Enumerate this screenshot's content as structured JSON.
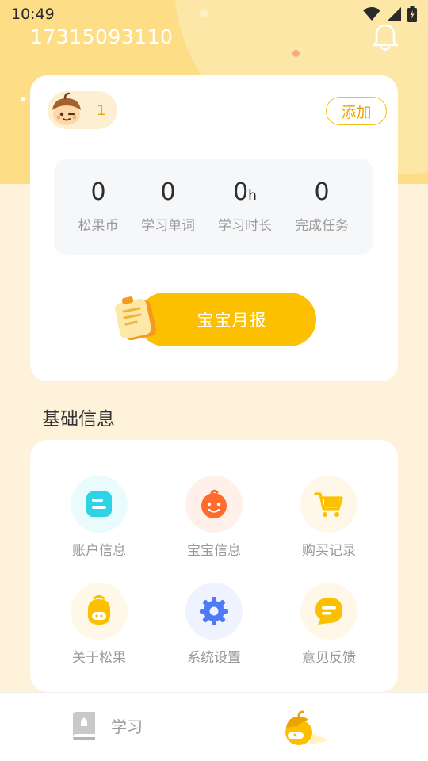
{
  "status_bar": {
    "time": "10:49"
  },
  "header": {
    "phone": "17315093110",
    "bell_icon": "bell-icon"
  },
  "kid": {
    "count": "1",
    "avatar_icon": "acorn-avatar-icon"
  },
  "add_button": "添加",
  "stats": [
    {
      "value": "0",
      "unit": "",
      "label": "松果币"
    },
    {
      "value": "0",
      "unit": "",
      "label": "学习单词"
    },
    {
      "value": "0",
      "unit": "h",
      "label": "学习时长"
    },
    {
      "value": "0",
      "unit": "",
      "label": "完成任务"
    }
  ],
  "report_button": "宝宝月报",
  "section": {
    "title": "基础信息"
  },
  "grid": [
    {
      "label": "账户信息",
      "icon": "account-icon",
      "bg": "#EAFBFD",
      "color": "#2ED3E6"
    },
    {
      "label": "宝宝信息",
      "icon": "baby-icon",
      "bg": "#FFF1EA",
      "color": "#FF6B2D"
    },
    {
      "label": "购买记录",
      "icon": "cart-icon",
      "bg": "#FFF8E8",
      "color": "#FCC000"
    },
    {
      "label": "关于松果",
      "icon": "pinecone-icon",
      "bg": "#FFF8E8",
      "color": "#FCC000"
    },
    {
      "label": "系统设置",
      "icon": "gear-icon",
      "bg": "#EEF3FF",
      "color": "#4E7BF5"
    },
    {
      "label": "意见反馈",
      "icon": "feedback-icon",
      "bg": "#FFF8E8",
      "color": "#FCC000"
    }
  ],
  "tabbar": {
    "study_label": "学习",
    "study_icon": "book-icon",
    "mine_icon": "acorn-mascot-icon"
  },
  "colors": {
    "accent": "#FCC000",
    "header_bg": "#FDDE86",
    "page_bg": "#FEF3DA"
  }
}
